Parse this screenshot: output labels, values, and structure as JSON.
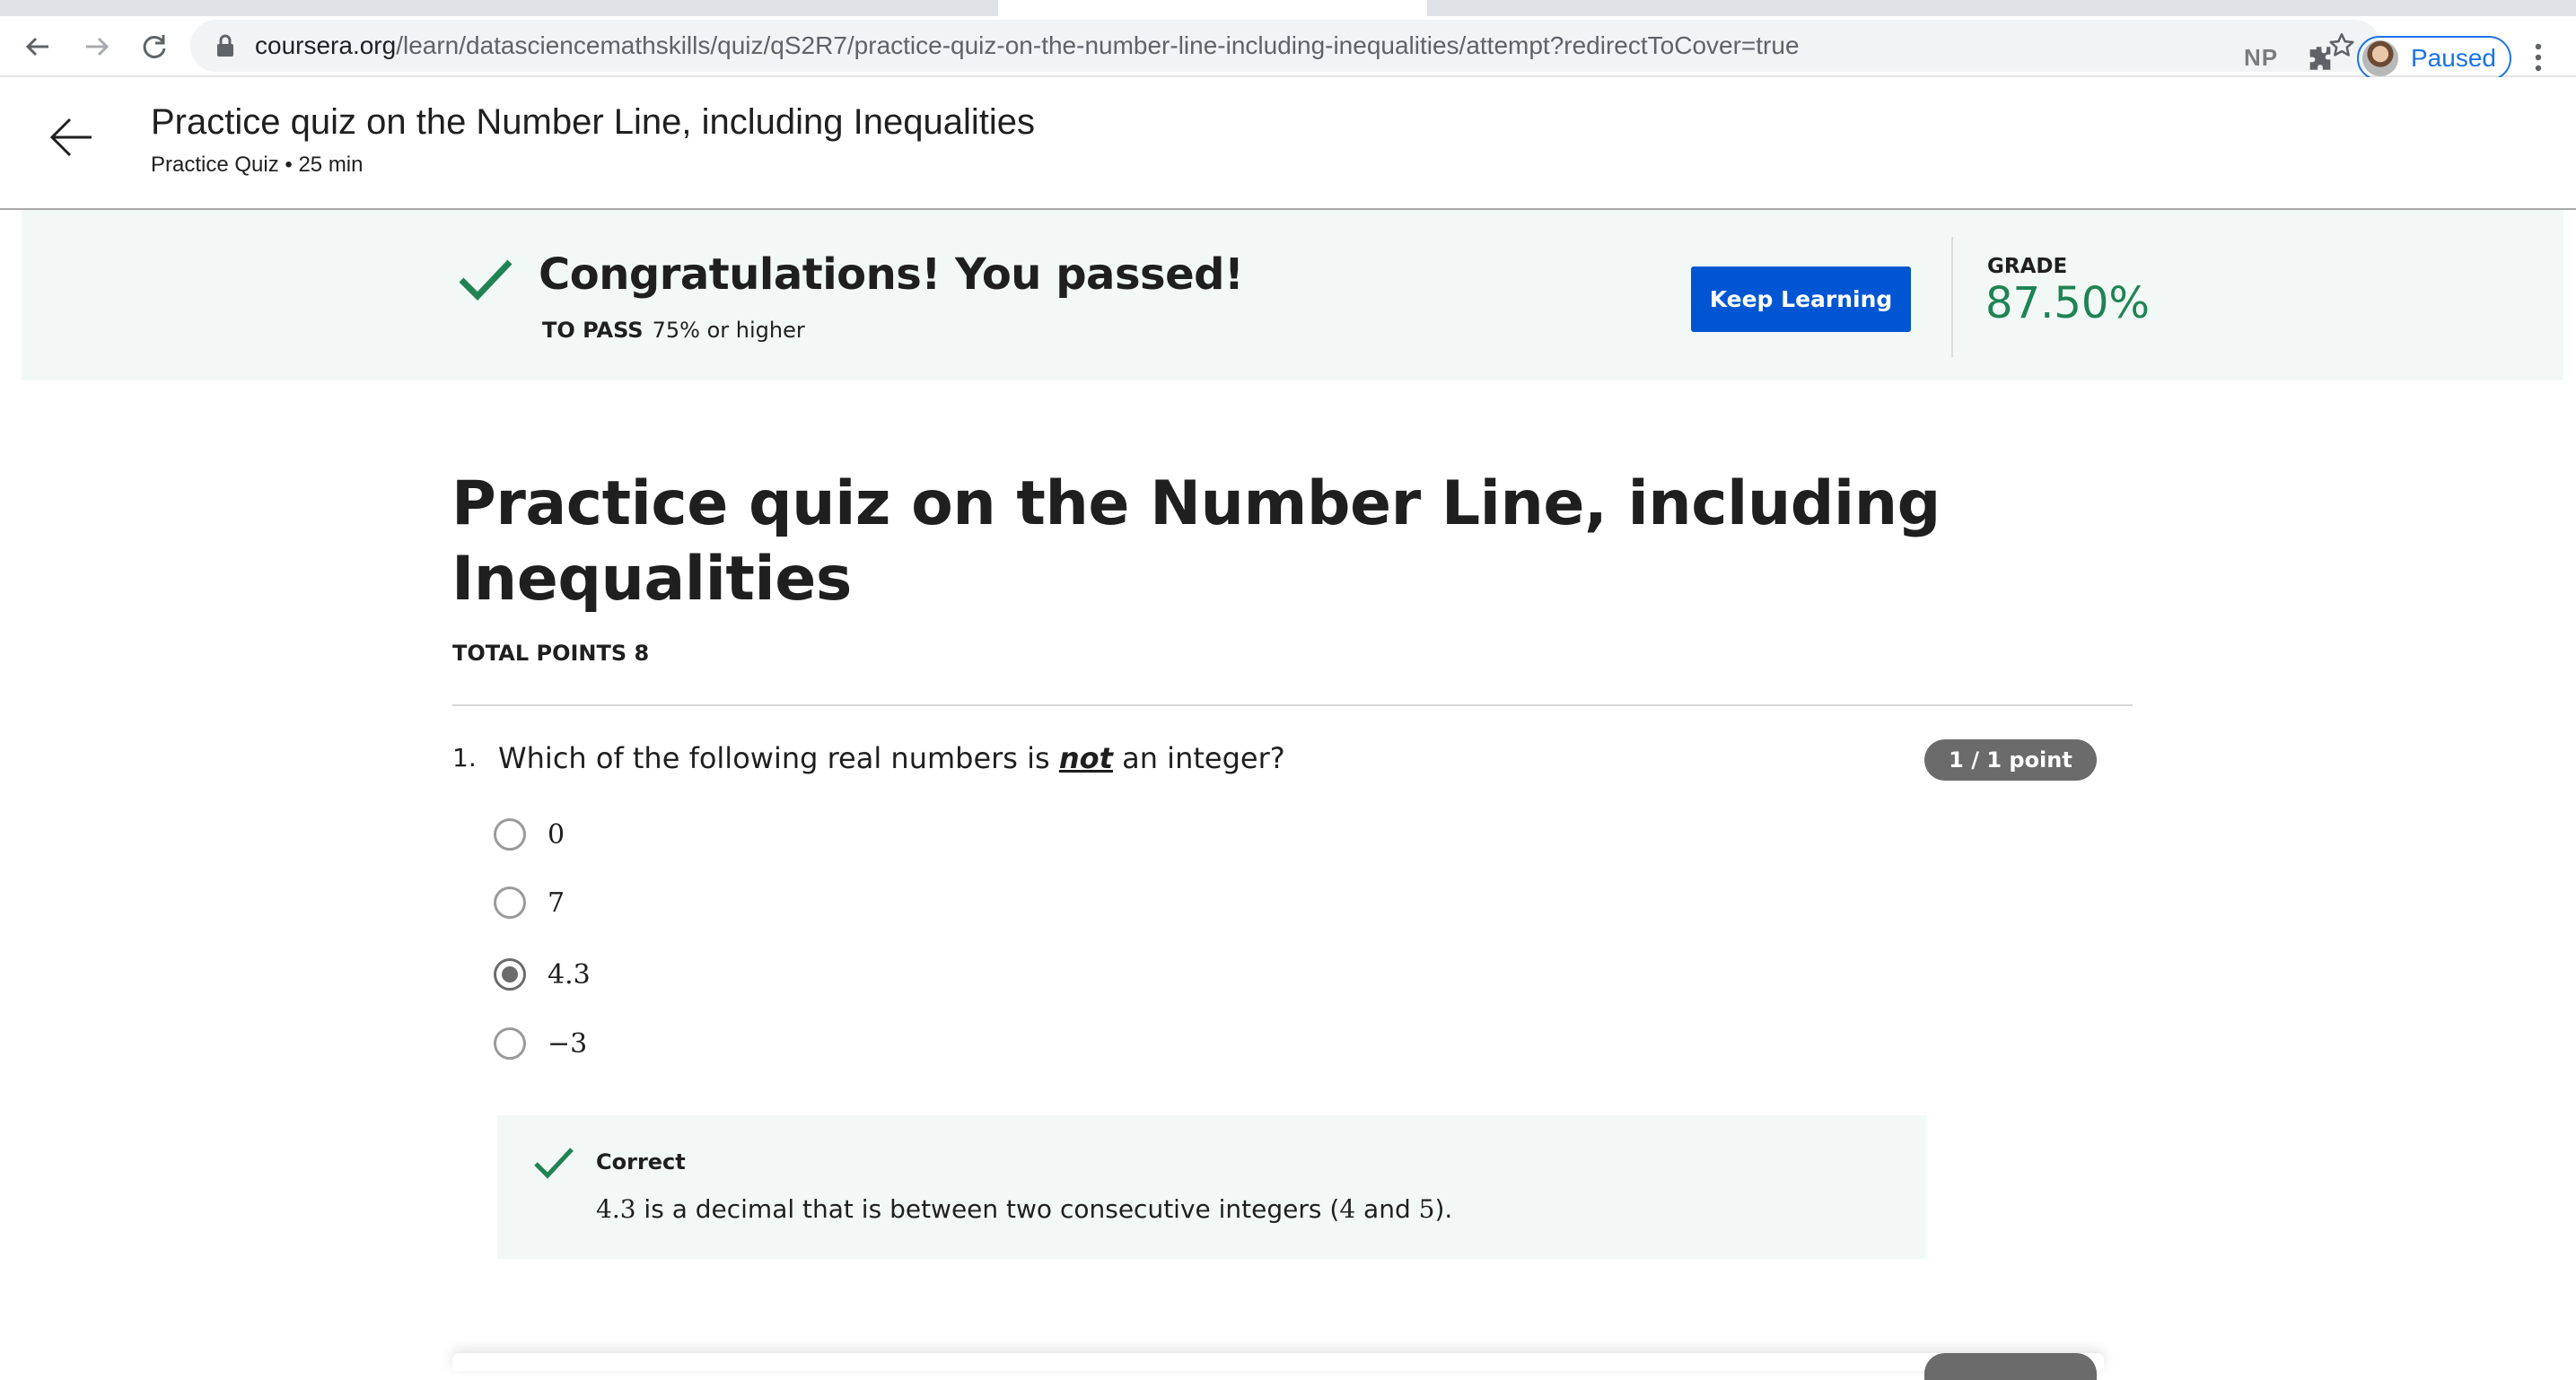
{
  "browser": {
    "url_host": "coursera.org",
    "url_path": "/learn/datasciencemathskills/quiz/qS2R7/practice-quiz-on-the-number-line-including-inequalities/attempt?redirectToCover=true",
    "extension_label": "NP",
    "profile_status": "Paused",
    "icons": [
      "back-arrow-icon",
      "forward-arrow-icon",
      "reload-icon",
      "lock-icon",
      "bookmark-star-icon",
      "puzzle-extension-icon",
      "kebab-menu-icon"
    ]
  },
  "header": {
    "title": "Practice quiz on the Number Line, including Inequalities",
    "subtitle": "Practice Quiz • 25 min"
  },
  "banner": {
    "message": "Congratulations! You passed!",
    "to_pass_label": "TO PASS",
    "to_pass_value": "75% or higher",
    "keep_learning_label": "Keep Learning",
    "grade_label": "GRADE",
    "grade_value": "87.50%",
    "colors": {
      "accent_green": "#1f8354",
      "button_blue": "#0056d2",
      "banner_bg": "#f2f8f6"
    }
  },
  "quiz": {
    "title": "Practice quiz on the Number Line, including Inequalities",
    "total_points": "TOTAL POINTS 8",
    "questions": [
      {
        "number": "1.",
        "text_before": "Which of the following real numbers is ",
        "text_emphasis": "not",
        "text_after": " an integer?",
        "points": "1 / 1 point",
        "options": [
          {
            "label": "0",
            "selected": false
          },
          {
            "label": "7",
            "selected": false
          },
          {
            "label": "4.3",
            "selected": true
          },
          {
            "label": "−3",
            "selected": false
          }
        ],
        "feedback": {
          "status": "Correct",
          "text_a": "4.3",
          "text_b": " is a decimal that is between two consecutive integers (",
          "text_c": "4",
          "text_d": " and ",
          "text_e": "5",
          "text_f": ")."
        }
      }
    ]
  }
}
